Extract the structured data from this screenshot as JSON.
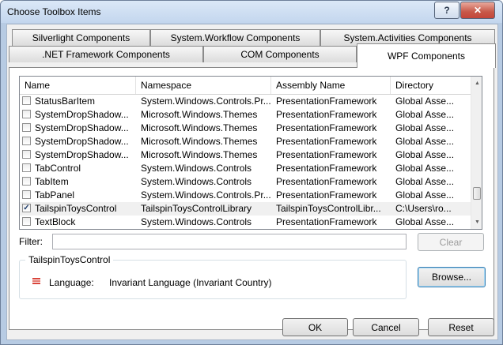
{
  "window": {
    "title": "Choose Toolbox Items",
    "help_label": "?",
    "close_label": "✕"
  },
  "tabs_row1": [
    {
      "label": "Silverlight Components"
    },
    {
      "label": "System.Workflow Components"
    },
    {
      "label": "System.Activities Components"
    }
  ],
  "tabs_row2": [
    {
      "label": ".NET Framework Components"
    },
    {
      "label": "COM Components"
    },
    {
      "label": "WPF Components",
      "active": true
    }
  ],
  "list": {
    "columns": [
      "Name",
      "Namespace",
      "Assembly Name",
      "Directory"
    ],
    "rows": [
      {
        "checked": false,
        "name": "StatusBarItem",
        "namespace": "System.Windows.Controls.Pr...",
        "assembly": "PresentationFramework",
        "directory": "Global Asse..."
      },
      {
        "checked": false,
        "name": "SystemDropShadow...",
        "namespace": "Microsoft.Windows.Themes",
        "assembly": "PresentationFramework",
        "directory": "Global Asse..."
      },
      {
        "checked": false,
        "name": "SystemDropShadow...",
        "namespace": "Microsoft.Windows.Themes",
        "assembly": "PresentationFramework",
        "directory": "Global Asse..."
      },
      {
        "checked": false,
        "name": "SystemDropShadow...",
        "namespace": "Microsoft.Windows.Themes",
        "assembly": "PresentationFramework",
        "directory": "Global Asse..."
      },
      {
        "checked": false,
        "name": "SystemDropShadow...",
        "namespace": "Microsoft.Windows.Themes",
        "assembly": "PresentationFramework",
        "directory": "Global Asse..."
      },
      {
        "checked": false,
        "name": "TabControl",
        "namespace": "System.Windows.Controls",
        "assembly": "PresentationFramework",
        "directory": "Global Asse..."
      },
      {
        "checked": false,
        "name": "TabItem",
        "namespace": "System.Windows.Controls",
        "assembly": "PresentationFramework",
        "directory": "Global Asse..."
      },
      {
        "checked": false,
        "name": "TabPanel",
        "namespace": "System.Windows.Controls.Pr...",
        "assembly": "PresentationFramework",
        "directory": "Global Asse..."
      },
      {
        "checked": true,
        "selected": true,
        "name": "TailspinToysControl",
        "namespace": "TailspinToysControlLibrary",
        "assembly": "TailspinToysControlLibr...",
        "directory": "C:\\Users\\ro..."
      },
      {
        "checked": false,
        "name": "TextBlock",
        "namespace": "System.Windows.Controls",
        "assembly": "PresentationFramework",
        "directory": "Global Asse..."
      }
    ],
    "scroll_up_icon": "▲",
    "scroll_down_icon": "▼"
  },
  "filter": {
    "label": "Filter:",
    "value": "",
    "clear_label": "Clear"
  },
  "details": {
    "group_title": "TailspinToysControl",
    "language_label": "Language:",
    "language_value": "Invariant Language (Invariant Country)",
    "browse_label": "Browse..."
  },
  "footer": {
    "ok_label": "OK",
    "cancel_label": "Cancel",
    "reset_label": "Reset"
  },
  "check_mark": "✓"
}
